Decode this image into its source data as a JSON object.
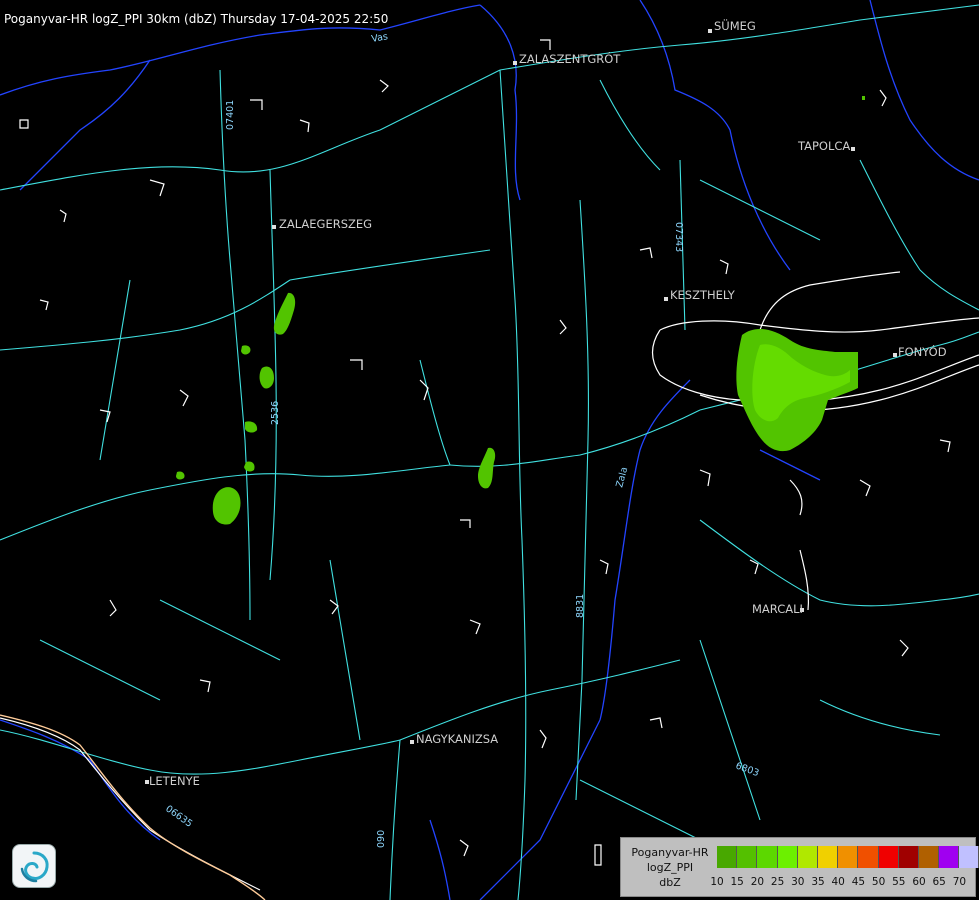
{
  "title": "Poganyvar-HR logZ_PPI 30km (dbZ) Thursday 17-04-2025 22:50",
  "cities": [
    {
      "id": "sumeg",
      "name": "SÜMEG"
    },
    {
      "id": "zalaszentgrot",
      "name": "ZALASZENTGRÓT"
    },
    {
      "id": "tapolca",
      "name": "TAPOLCA"
    },
    {
      "id": "zalaegerszeg",
      "name": "ZALAEGERSZEG"
    },
    {
      "id": "keszthely",
      "name": "KESZTHELY"
    },
    {
      "id": "fonyod",
      "name": "FONYÓD"
    },
    {
      "id": "marcali",
      "name": "MARCALI"
    },
    {
      "id": "nagykanizsa",
      "name": "NAGYKANIZSA"
    },
    {
      "id": "letenye",
      "name": "LETENYE"
    }
  ],
  "road_labels": [
    "Vas",
    "Zala",
    "07343",
    "07401",
    "2536",
    "8831",
    "6803",
    "06635",
    "090"
  ],
  "legend": {
    "line1": "Poganyvar-HR",
    "line2": "logZ_PPI",
    "line3": "dbZ",
    "ticks": [
      "10",
      "15",
      "20",
      "25",
      "30",
      "35",
      "40",
      "45",
      "50",
      "55",
      "60",
      "65",
      "70"
    ],
    "colors": [
      "#48a800",
      "#54c000",
      "#5cd800",
      "#6cf000",
      "#b0e800",
      "#f0d000",
      "#f09000",
      "#f05000",
      "#f00000",
      "#a00000",
      "#b06000",
      "#a000f0",
      "#c0c0ff"
    ]
  },
  "colors": {
    "background": "#000000",
    "roads": "#40e0e0",
    "rivers": "#2040ff",
    "borders": "#ffffff",
    "country_border": "#ffcc99",
    "echo_weak": "#48b000",
    "echo_mid": "#6cd800"
  },
  "icons": {
    "logo": "met-service-swirl-icon"
  }
}
